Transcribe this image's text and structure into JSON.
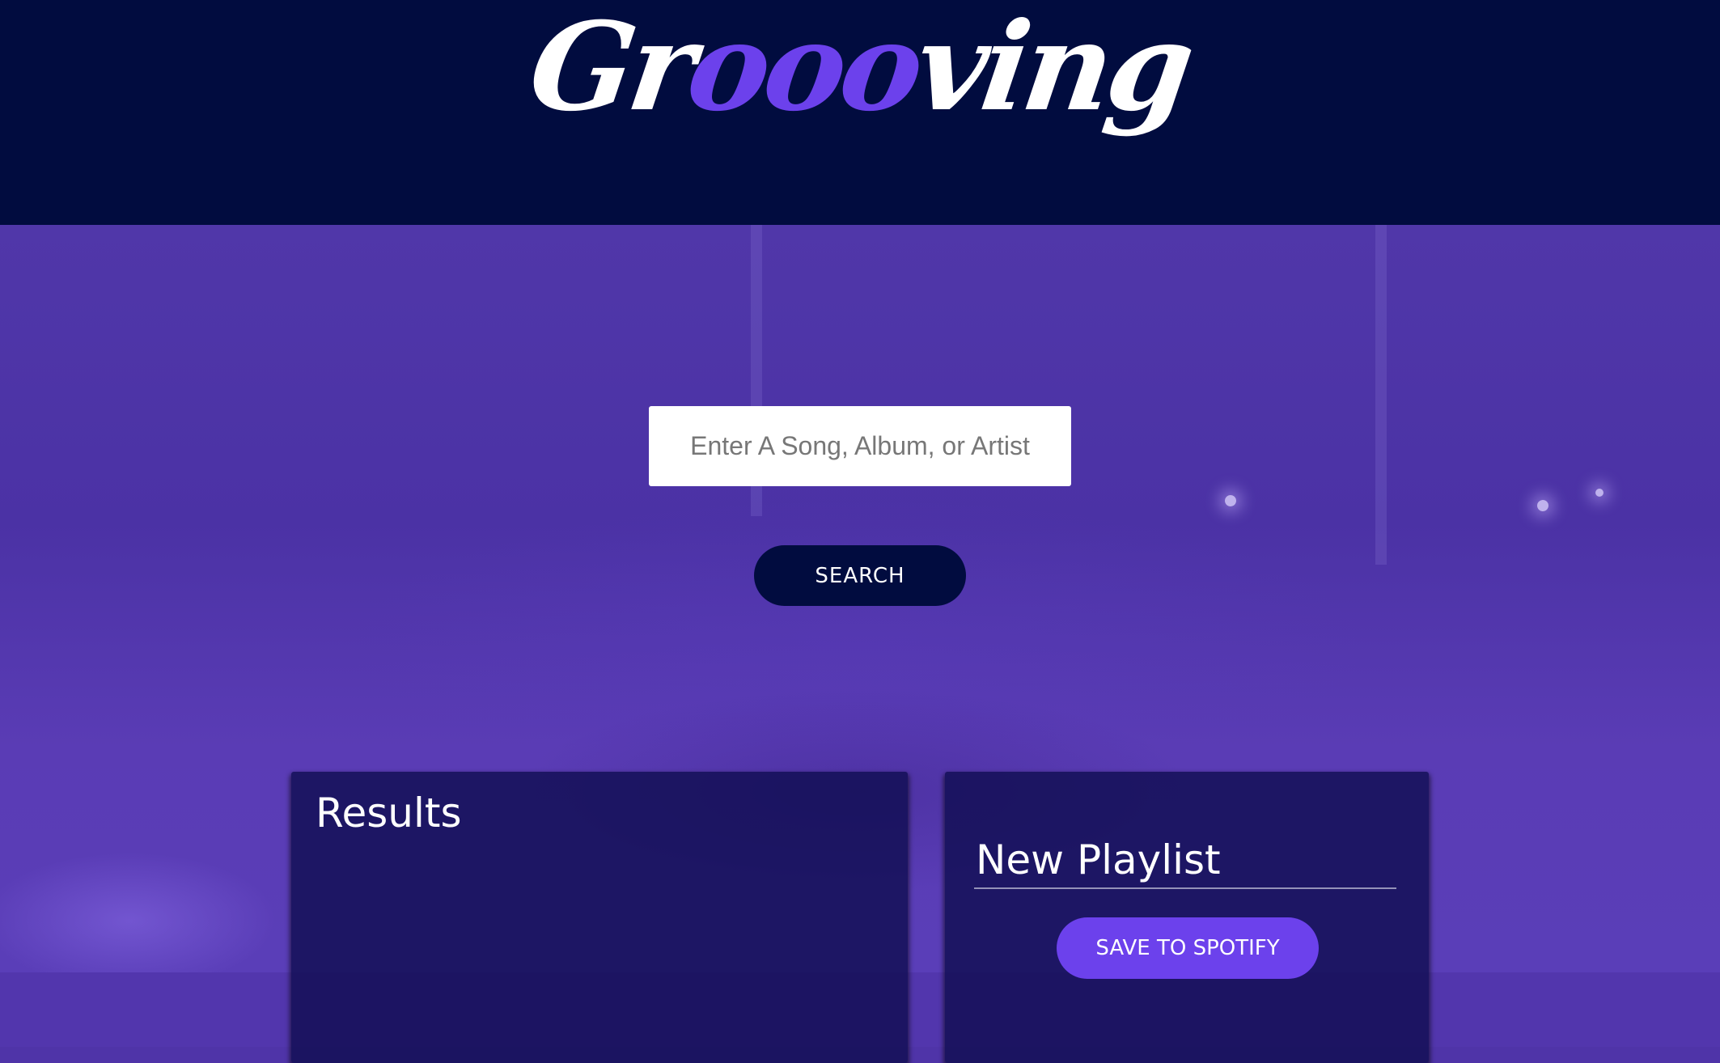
{
  "header": {
    "logo_prefix": "Gr",
    "logo_accent": "ooo",
    "logo_suffix": "ving"
  },
  "search": {
    "placeholder": "Enter A Song, Album, or Artist",
    "value": "",
    "button_label": "SEARCH"
  },
  "results": {
    "title": "Results",
    "tracks": []
  },
  "playlist": {
    "name": "New Playlist",
    "save_label": "SAVE TO SPOTIFY",
    "tracks": []
  },
  "colors": {
    "header_bg": "#010c3f",
    "accent": "#6c41ec",
    "hero_bg": "#4f34a8",
    "panel_bg": "#100e52",
    "button_dark": "#010c3f",
    "text": "#ffffff"
  }
}
